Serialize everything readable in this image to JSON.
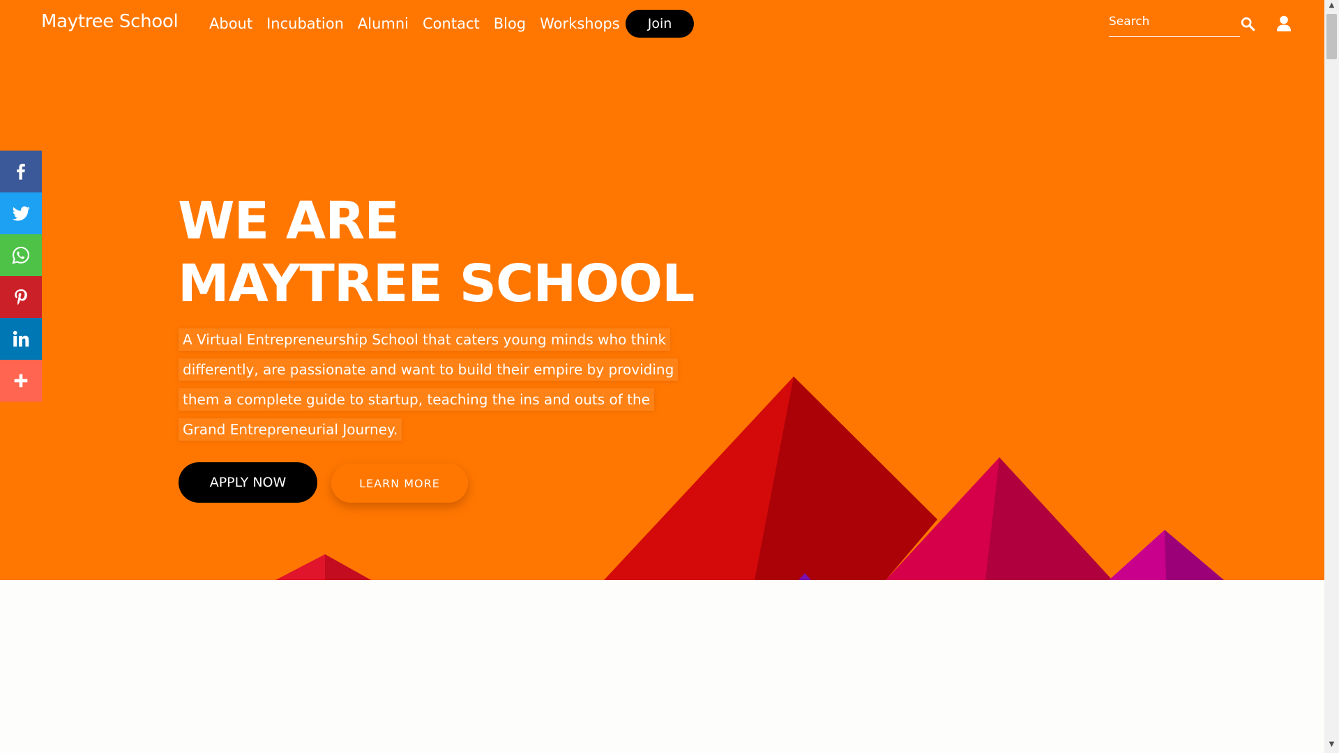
{
  "header": {
    "brand": "Maytree School",
    "nav": [
      "About",
      "Incubation",
      "Alumni",
      "Contact",
      "Blog",
      "Workshops"
    ],
    "join_label": "Join",
    "search_placeholder": "Search",
    "search_icon": "search-icon",
    "user_icon": "user-icon"
  },
  "share_bar": [
    {
      "name": "facebook",
      "icon": "facebook-icon",
      "color": "#3b5998"
    },
    {
      "name": "twitter",
      "icon": "twitter-icon",
      "color": "#1da1f2"
    },
    {
      "name": "whatsapp",
      "icon": "whatsapp-icon",
      "color": "#4dc247"
    },
    {
      "name": "pinterest",
      "icon": "pinterest-icon",
      "color": "#cb2027"
    },
    {
      "name": "linkedin",
      "icon": "linkedin-icon",
      "color": "#0077b5"
    },
    {
      "name": "more",
      "icon": "plus-icon",
      "color": "#ff6550"
    }
  ],
  "hero": {
    "title_line1": "WE ARE",
    "title_line2": "MAYTREE SCHOOL",
    "description": "A Virtual Entrepreneurship School that caters young minds who think differently, are passionate and want to build their empire by providing them a complete guide to startup, teaching the ins and outs of the Grand Entrepreneurial Journey.",
    "apply_label": "APPLY NOW",
    "learn_label": "LEARN MORE"
  },
  "colors": {
    "hero_background": "#ff7700",
    "button_dark": "#000000",
    "text": "#ffffff"
  }
}
